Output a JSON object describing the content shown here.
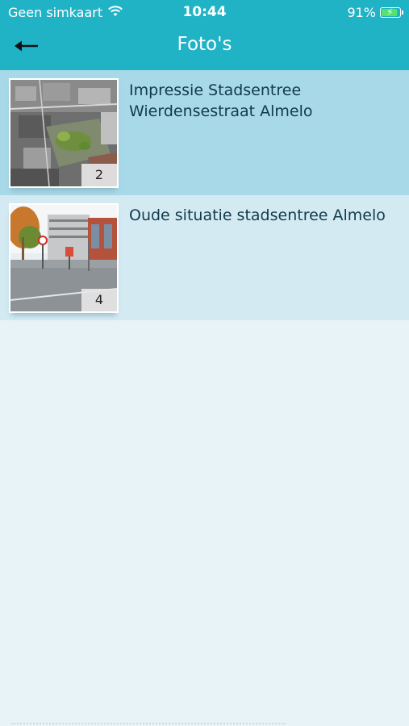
{
  "status_bar": {
    "carrier": "Geen simkaart",
    "time": "10:44",
    "battery": "91%",
    "battery_level": 0.91
  },
  "header": {
    "title": "Foto's",
    "back_icon": "arrow-left-icon"
  },
  "albums": [
    {
      "title": "Impressie Stadsentree Wierdensestraat Almelo",
      "count": "2"
    },
    {
      "title": "Oude situatie stadsentree Almelo",
      "count": "4"
    }
  ],
  "colors": {
    "accent": "#20b3c6",
    "selected_row": "#a8d9e8",
    "row": "#d3eaf3",
    "background": "#e8f3f8"
  }
}
